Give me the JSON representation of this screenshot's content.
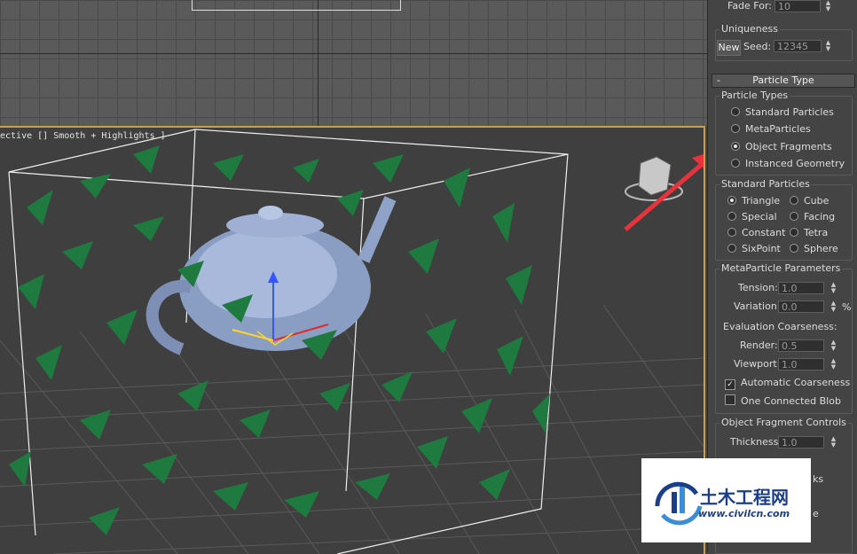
{
  "viewport_top": {},
  "viewport_persp": {
    "label": "ective [] Smooth + Highlights ]"
  },
  "panel": {
    "fade_for": {
      "label": "Fade For:",
      "value": "10"
    },
    "uniqueness": {
      "title": "Uniqueness",
      "new_label": "New",
      "seed_label": "Seed:",
      "seed_value": "12345"
    },
    "particle_type_rollout": {
      "minus": "-",
      "title": "Particle Type"
    },
    "particle_types": {
      "title": "Particle Types",
      "options": [
        "Standard Particles",
        "MetaParticles",
        "Object Fragments",
        "Instanced Geometry"
      ],
      "selected": "Object Fragments"
    },
    "standard_particles": {
      "title": "Standard Particles",
      "col1": [
        "Triangle",
        "Special",
        "Constant",
        "SixPoint"
      ],
      "col2": [
        "Cube",
        "Facing",
        "Tetra",
        "Sphere"
      ],
      "selected": "Triangle"
    },
    "meta_params": {
      "title": "MetaParticle Parameters",
      "tension_label": "Tension:",
      "tension_value": "1.0",
      "variation_label": "Variation:",
      "variation_value": "0.0",
      "percent": "%",
      "eval_label": "Evaluation Coarseness:",
      "render_label": "Render:",
      "render_value": "0.5",
      "viewport_label": "Viewport:",
      "viewport_value": "1.0",
      "auto_coarse": "Automatic Coarseness",
      "one_blob": "One Connected Blob"
    },
    "fragment_controls": {
      "title": "Object Fragment Controls",
      "thickness_label": "Thickness:",
      "thickness_value": "1.0",
      "partial_a": "ks",
      "partial_b": "e"
    }
  },
  "watermark": {
    "title": "土木工程网",
    "url": "www.civilcn.com"
  },
  "colors": {
    "accent_border": "#c7a04a",
    "fragment_green": "#1e7a3e",
    "arrow_red": "#e8323c"
  }
}
